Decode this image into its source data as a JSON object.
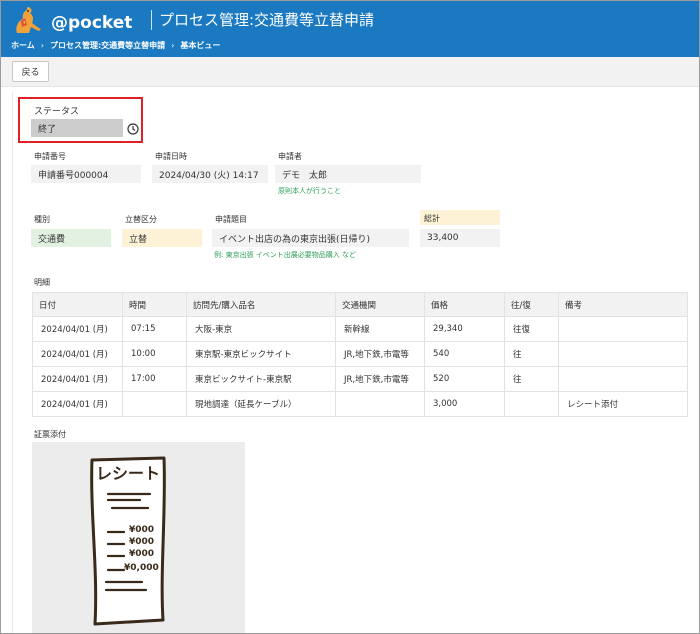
{
  "header": {
    "logo_text": "@pocket",
    "title": "プロセス管理:交通費等立替申請",
    "breadcrumb": [
      "ホーム",
      "プロセス管理:交通費等立替申請",
      "基本ビュー"
    ],
    "breadcrumb_sep": "›"
  },
  "toolbar": {
    "back_label": "戻る"
  },
  "status": {
    "label": "ステータス",
    "value": "終了"
  },
  "request": {
    "number_label": "申請番号",
    "number_value": "申請番号000004",
    "date_label": "申請日時",
    "date_value": "2024/04/30 (火) 14:17",
    "applicant_label": "申請者",
    "applicant_value": "デモ　太郎",
    "applicant_hint": "原則本人が行うこと"
  },
  "details": {
    "type_label": "種別",
    "type_value": "交通費",
    "category_label": "立替区分",
    "category_value": "立替",
    "subject_label": "申請題目",
    "subject_value": "イベント出店の為の東京出張(日帰り)",
    "subject_hint": "例: 東京出張 イベント出展必要物品購入 など",
    "total_label": "総計",
    "total_value": "33,400"
  },
  "colors": {
    "header_bg": "#1a79c0",
    "type_bg": "#e3f1e3",
    "category_bg": "#fdf1d6",
    "total_bg": "#fdf1d6",
    "status_bg": "#cccccc",
    "highlight_border": "#e01f26",
    "hint_color": "#2f9e59"
  },
  "meisai": {
    "title": "明細",
    "headers": [
      "日付",
      "時間",
      "訪問先/購入品名",
      "交通機関",
      "価格",
      "往/復",
      "備考"
    ],
    "rows": [
      [
        "2024/04/01 (月)",
        "07:15",
        "大阪-東京",
        "新幹線",
        "29,340",
        "往復",
        ""
      ],
      [
        "2024/04/01 (月)",
        "10:00",
        "東京駅-東京ビックサイト",
        "JR,地下鉄,市電等",
        "540",
        "往",
        ""
      ],
      [
        "2024/04/01 (月)",
        "17:00",
        "東京ビックサイト-東京駅",
        "JR,地下鉄,市電等",
        "520",
        "往",
        ""
      ],
      [
        "2024/04/01 (月)",
        "",
        "現地調達（延長ケーブル）",
        "",
        "3,000",
        "",
        "レシート添付"
      ]
    ]
  },
  "attachment": {
    "label": "証票添付",
    "receipt_title": "レシート",
    "receipt_lines": [
      "¥000",
      "¥000",
      "¥000",
      "¥0,000"
    ]
  },
  "icons": {
    "status_icon": "clock-icon",
    "logo_icon": "kangaroo-logo-icon"
  }
}
